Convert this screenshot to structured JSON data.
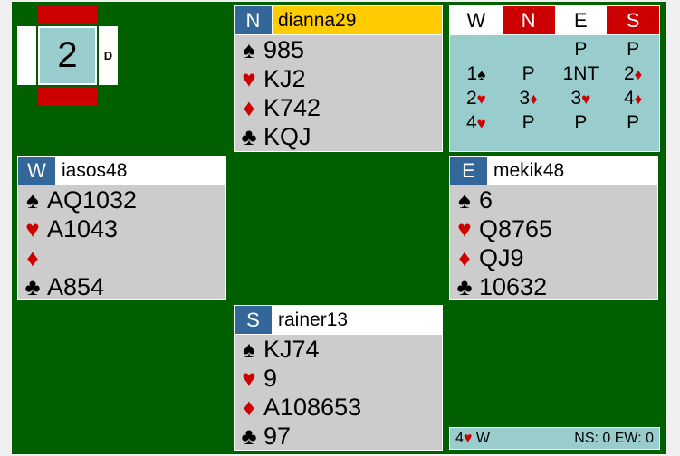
{
  "board": {
    "number": "2",
    "dealer_marker": "D"
  },
  "colors": {
    "felt": "#006000",
    "vulnerable": "#cc0000",
    "seat": "#336699",
    "turn": "#ffcc00",
    "panel": "#99cccc",
    "hand": "#cccccc"
  },
  "hands": {
    "north": {
      "seat": "N",
      "player": "dianna29",
      "spades": "985",
      "hearts": "KJ2",
      "diamonds": "K742",
      "clubs": "KQJ"
    },
    "west": {
      "seat": "W",
      "player": "iasos48",
      "spades": "AQ1032",
      "hearts": "A1043",
      "diamonds": "",
      "clubs": "A854"
    },
    "east": {
      "seat": "E",
      "player": "mekik48",
      "spades": "6",
      "hearts": "Q8765",
      "diamonds": "QJ9",
      "clubs": "10632"
    },
    "south": {
      "seat": "S",
      "player": "rainer13",
      "spades": "KJ74",
      "hearts": "9",
      "diamonds": "A108653",
      "clubs": "97"
    }
  },
  "suit_symbols": {
    "spades": "♠",
    "hearts": "♥",
    "diamonds": "♦",
    "clubs": "♣"
  },
  "auction": {
    "headers": [
      "W",
      "N",
      "E",
      "S"
    ],
    "calls": [
      [
        "",
        "",
        "P",
        "P"
      ],
      [
        "1♠",
        "P",
        "1NT",
        "2♦"
      ],
      [
        "2♥",
        "3♦",
        "3♥",
        "4♦"
      ],
      [
        "4♥",
        "P",
        "P",
        "P"
      ]
    ]
  },
  "footer": {
    "contract_level": "4",
    "contract_suit": "♥",
    "declarer": "W",
    "score": "NS: 0 EW: 0"
  }
}
